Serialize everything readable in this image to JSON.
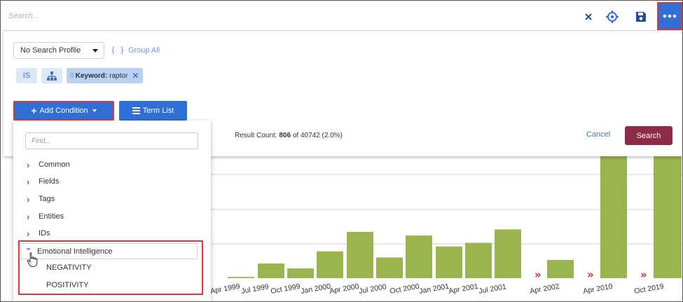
{
  "search": {
    "placeholder": "Search..."
  },
  "toolbar": {
    "clear_icon": "close-icon",
    "locate_icon": "target-icon",
    "save_icon": "save-icon",
    "more_icon": "more-horizontal-icon"
  },
  "panel": {
    "profile_select": "No Search Profile",
    "group_all": "Group All",
    "chips": {
      "is_label": "IS",
      "hierarchy_icon": "sitemap-icon",
      "keyword_label": "Keyword:",
      "keyword_value": "raptor"
    },
    "add_condition_label": "Add Condition",
    "term_list_label": "Term List",
    "result_count_label": "Result Count:",
    "result_count_value": "806",
    "result_count_total": "of 40742 (2.0%)",
    "cancel_label": "Cancel",
    "search_label": "Search"
  },
  "menu": {
    "find_placeholder": "Find...",
    "items": [
      "Common",
      "Fields",
      "Tags",
      "Entities",
      "IDs"
    ],
    "expanded": {
      "label": "Emotional Intelligence",
      "children": [
        "NEGATIVITY",
        "POSITIVITY"
      ]
    }
  },
  "colors": {
    "accent": "#2f6fd6",
    "search_button": "#8e2b48",
    "bar": "#9bb54e",
    "break_marker": "#d02a2a",
    "highlight": "#d63a3a",
    "chip_bg": "#dce8f7"
  },
  "chart_data": {
    "type": "bar",
    "x_tick_labels": [
      "Apr 1999",
      "Jul 1999",
      "Oct 1999",
      "Jan 2000",
      "Apr 2000",
      "Jul 2000",
      "Oct 2000",
      "Jan 2001",
      "Apr 2001",
      "Jul 2001",
      "Apr 2002",
      "Apr 2010",
      "Oct 2019"
    ],
    "bars_visible_relative": [
      0.01,
      0.12,
      0.08,
      0.22,
      0.38,
      0.17,
      0.35,
      0.26,
      0.29,
      0.4,
      0.15,
      1.0,
      1.0
    ],
    "axis_breaks_after": [
      "Jul 2001",
      "Apr 2002",
      "Apr 2010"
    ],
    "grid": true,
    "note": "most bars partly hidden behind the search panel; y axis not visible"
  }
}
